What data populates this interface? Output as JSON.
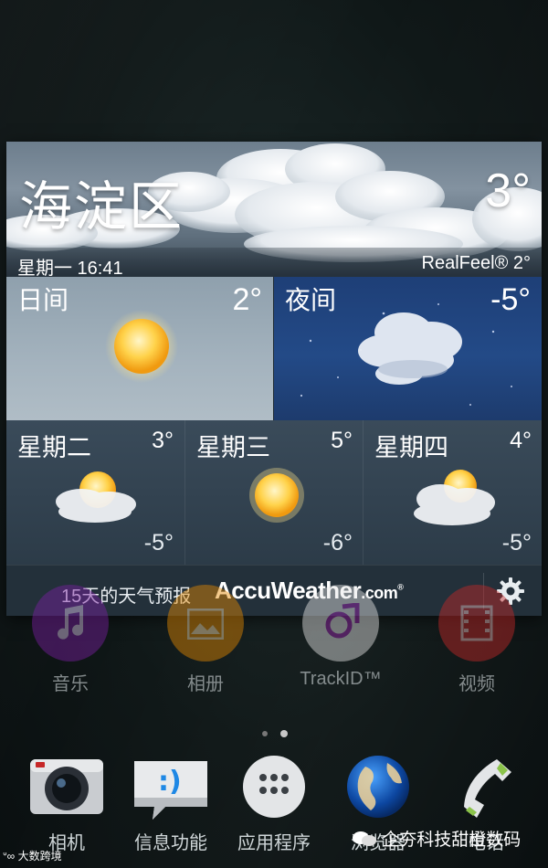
{
  "widget": {
    "current": {
      "city": "海淀区",
      "temp": "3°",
      "day_time": "星期一 16:41",
      "realfeel": "RealFeel® 2°"
    },
    "day": {
      "label": "日间",
      "temp": "2°",
      "icon": "sun-icon"
    },
    "night": {
      "label": "夜间",
      "temp": "-5°",
      "icon": "cloud-night-icon"
    },
    "forecast": [
      {
        "day": "星期二",
        "high": "3°",
        "low": "-5°",
        "icon": "sun-behind-cloud-icon"
      },
      {
        "day": "星期三",
        "high": "5°",
        "low": "-6°",
        "icon": "sun-icon"
      },
      {
        "day": "星期四",
        "high": "4°",
        "low": "-5°",
        "icon": "sun-behind-cloud-icon"
      }
    ],
    "footer": {
      "forecast_15": "15天的天气预报",
      "brand_main": "AccuWeather",
      "brand_suffix": ".com",
      "brand_mark": "®",
      "settings_icon": "gear-icon"
    }
  },
  "apps": [
    {
      "label": "音乐",
      "icon": "music-note-icon",
      "color": "#7b1fa2"
    },
    {
      "label": "相册",
      "icon": "photo-album-icon",
      "color": "#e68a00"
    },
    {
      "label": "TrackID™",
      "icon": "trackid-icon",
      "color": "#e8e8e8"
    },
    {
      "label": "视频",
      "icon": "film-icon",
      "color": "#c62828"
    }
  ],
  "dock": [
    {
      "label": "相机",
      "icon": "camera-icon"
    },
    {
      "label": "信息功能",
      "icon": "message-icon"
    },
    {
      "label": "应用程序",
      "icon": "app-drawer-icon"
    },
    {
      "label": "浏览器",
      "icon": "globe-icon"
    },
    {
      "label": "电话",
      "icon": "phone-icon"
    }
  ],
  "page_indicator": {
    "pages": 2,
    "current": 2
  },
  "watermarks": {
    "right": "企夯科技甜橙数码",
    "left": "大数跨境"
  }
}
